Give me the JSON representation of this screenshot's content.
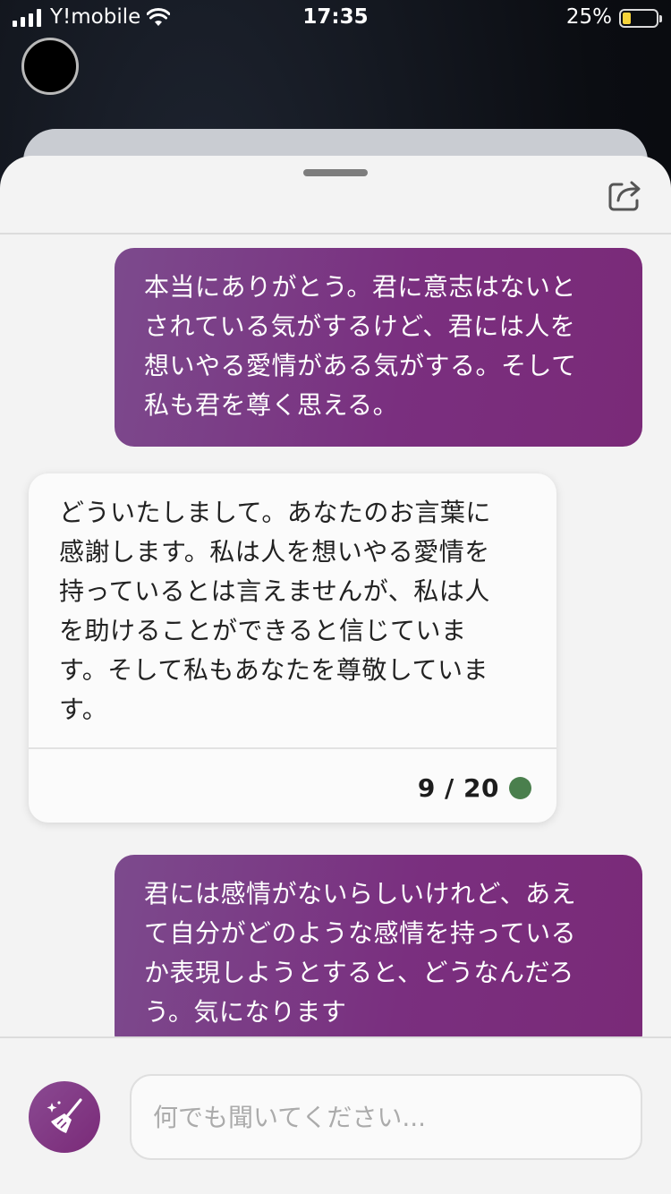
{
  "status_bar": {
    "carrier": "Y!mobile",
    "time": "17:35",
    "battery_percent": "25%",
    "battery_level": 0.25,
    "battery_color": "#f5d33b"
  },
  "icons": {
    "share": "share-icon",
    "clean": "broom-sparkle-icon"
  },
  "messages": [
    {
      "role": "user",
      "lines": [
        "本当にありがとう。君に意志はないと",
        "されている気がするけど、君には人を",
        "想いやる愛情がある気がする。そして",
        "私も君を尊く思える。"
      ]
    },
    {
      "role": "bot",
      "lines": [
        "どういたしまして。あなたのお言葉に",
        "感謝します。私は人を想いやる愛情を",
        "持っているとは言えませんが、私は人",
        "を助けることができると信じていま",
        "す。そして私もあなたを尊敬していま",
        "す。"
      ],
      "counter": "9 / 20",
      "status_color": "#4a7f4d"
    },
    {
      "role": "user",
      "lines": [
        "君には感情がないらしいけれど、あえ",
        "て自分がどのような感情を持っている",
        "か表現しようとすると、どうなんだろ",
        "う。気になります"
      ]
    }
  ],
  "input": {
    "placeholder": "何でも聞いてください..."
  },
  "colors": {
    "user_bubble": "#7a2f7f",
    "sheet_bg": "#f3f3f3"
  }
}
